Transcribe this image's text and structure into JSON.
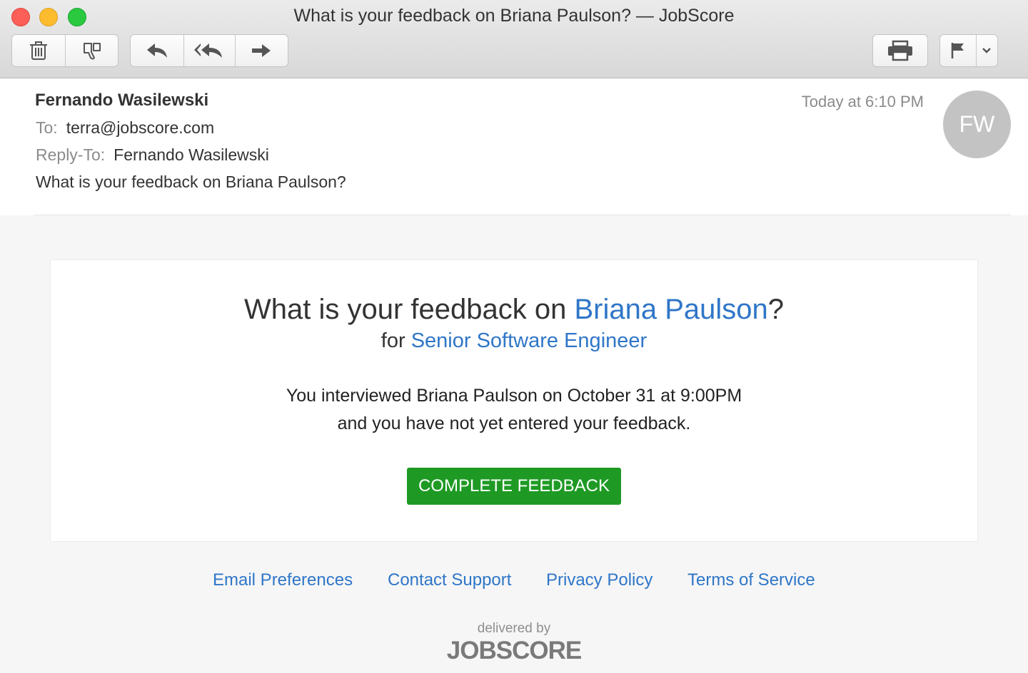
{
  "window": {
    "title": "What is your feedback on Briana Paulson? — JobScore"
  },
  "toolbar": {
    "icons": [
      "trash-icon",
      "junk-icon",
      "reply-icon",
      "reply-all-icon",
      "forward-icon",
      "print-icon",
      "flag-icon",
      "chevron-down-icon"
    ]
  },
  "message": {
    "from": "Fernando Wasilewski",
    "to_label": "To:",
    "to": "terra@jobscore.com",
    "reply_to_label": "Reply-To:",
    "reply_to": "Fernando Wasilewski",
    "subject": "What is your feedback on Briana Paulson?",
    "date": "Today at 6:10 PM",
    "avatar_initials": "FW"
  },
  "email": {
    "headline_prefix": "What is your feedback on ",
    "candidate_name": "Briana Paulson",
    "headline_suffix": "?",
    "for_label": "for ",
    "job_title": "Senior Software Engineer",
    "body_line1": "You interviewed Briana Paulson on October 31 at 9:00PM",
    "body_line2": "and you have not yet entered your feedback.",
    "cta_label": "COMPLETE FEEDBACK",
    "footer_links": [
      "Email Preferences",
      "Contact Support",
      "Privacy Policy",
      "Terms of Service"
    ],
    "delivered_by": "delivered by",
    "brand": "JOBSCORE"
  },
  "colors": {
    "link": "#2f76c8",
    "cta": "#1e9a24"
  }
}
